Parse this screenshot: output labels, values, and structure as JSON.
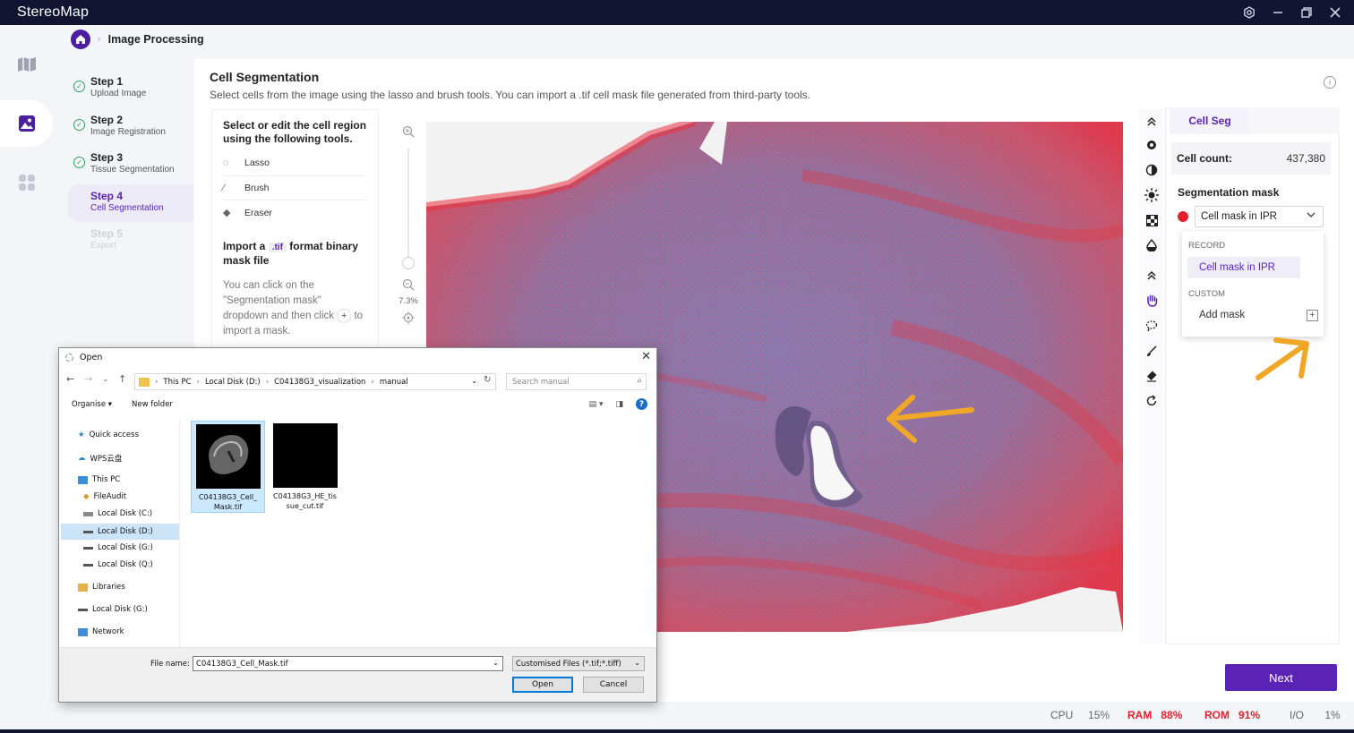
{
  "app": {
    "title": "StereoMap",
    "brand_color": "#5a23b5",
    "titlebar_color": "#121531"
  },
  "window_controls": {
    "settings": "settings-icon",
    "minimize": "minimize-icon",
    "maximize": "maximize-icon",
    "close": "close-icon"
  },
  "breadcrumb": {
    "home_icon": "home-icon",
    "current": "Image Processing"
  },
  "steps": [
    {
      "title": "Step 1",
      "subtitle": "Upload Image",
      "state": "done"
    },
    {
      "title": "Step 2",
      "subtitle": "Image Registration",
      "state": "done"
    },
    {
      "title": "Step 3",
      "subtitle": "Tissue Segmentation",
      "state": "done"
    },
    {
      "title": "Step 4",
      "subtitle": "Cell Segmentation",
      "state": "active"
    },
    {
      "title": "Step 5",
      "subtitle": "Export",
      "state": "disabled"
    }
  ],
  "section": {
    "title": "Cell Segmentation",
    "description": "Select cells from the image using the lasso and brush tools. You can import a .tif cell mask file generated from third-party tools."
  },
  "tools_panel": {
    "heading": "Select or edit the cell region using the following tools.",
    "tools": [
      {
        "label": "Lasso",
        "icon": "lasso-icon"
      },
      {
        "label": "Brush",
        "icon": "brush-icon"
      },
      {
        "label": "Eraser",
        "icon": "eraser-icon"
      }
    ],
    "import_heading_pre": "Import a",
    "import_tag": ".tif",
    "import_heading_post": "format binary mask file",
    "note": "You can click on the \"Segmentation mask\" dropdown and then click",
    "note_end": "to import a mask."
  },
  "zoom": {
    "level": "7.3%",
    "slider_fraction": 0.05
  },
  "right_panel": {
    "tab": "Cell Seg",
    "cell_count_label": "Cell count:",
    "cell_count_value": "437,380",
    "mask_label": "Segmentation mask",
    "mask_color": "#e4202a",
    "mask_selected": "Cell mask in IPR",
    "dropdown": {
      "record_header": "RECORD",
      "record_item": "Cell mask in IPR",
      "custom_header": "CUSTOM",
      "custom_item": "Add mask"
    }
  },
  "next_button": "Next",
  "status": {
    "cpu_label": "CPU",
    "cpu": "15%",
    "ram_label": "RAM",
    "ram": "88%",
    "rom_label": "ROM",
    "rom": "91%",
    "io_label": "I/O",
    "io": "1%"
  },
  "dialog": {
    "title": "Open",
    "path": [
      "This PC",
      "Local Disk (D:)",
      "C04138G3_visualization",
      "manual"
    ],
    "search_placeholder": "Search manual",
    "organise": "Organise",
    "new_folder": "New folder",
    "nav": [
      "Quick access",
      "WPS云盘",
      "This PC",
      "FileAudit",
      "Local Disk (C:)",
      "Local Disk (D:)",
      "Local Disk (G:)",
      "Local Disk (Q:)",
      "Libraries",
      "Local Disk  (G:)",
      "Network"
    ],
    "files": [
      {
        "name": "C04138G3_Cell_Mask.tif",
        "line1": "C04138G3_Cell_",
        "line2": "Mask.tif"
      },
      {
        "name": "C04138G3_HE_tissue_cut.tif",
        "line1": "C04138G3_HE_tis",
        "line2": "sue_cut.tif"
      }
    ],
    "file_name_label": "File name:",
    "file_name": "C04138G3_Cell_Mask.tif",
    "file_type": "Customised Files (*.tif;*.tiff)",
    "open_button": "Open",
    "cancel_button": "Cancel"
  }
}
